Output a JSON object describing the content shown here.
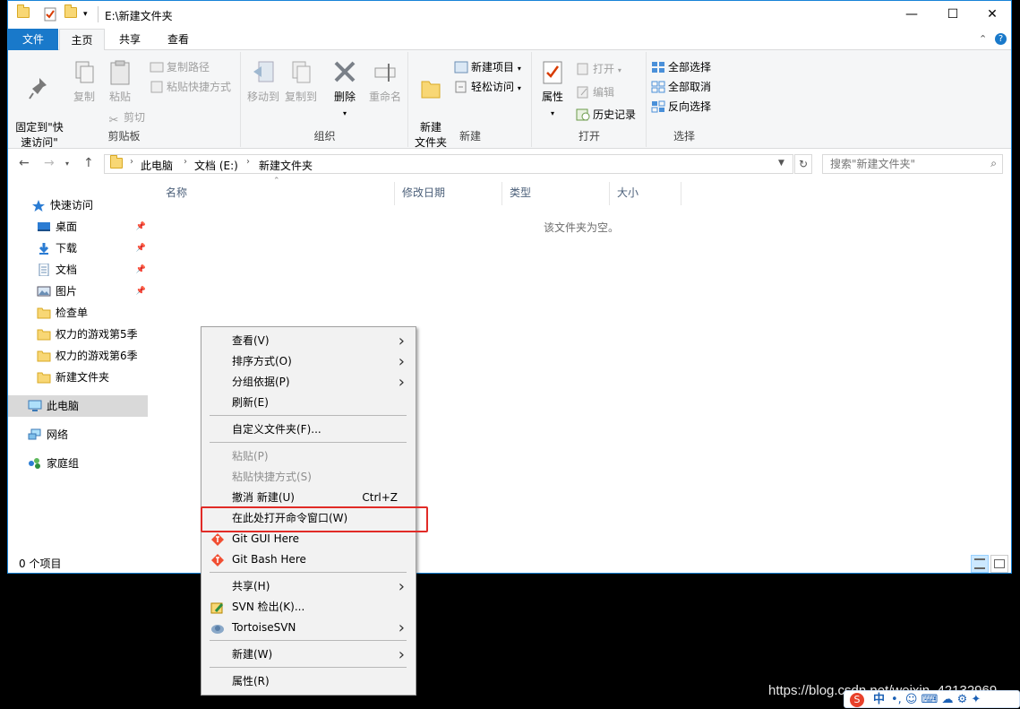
{
  "window": {
    "title": "E:\\新建文件夹",
    "minimize_glyph": "—",
    "maximize_glyph": "☐",
    "close_glyph": "✕"
  },
  "tabs": {
    "file": "文件",
    "home": "主页",
    "share": "共享",
    "view": "查看"
  },
  "ribbon": {
    "clipboard": {
      "group": "剪贴板",
      "pin_quick": "固定到\"快\n速访问\"",
      "copy": "复制",
      "paste": "粘贴",
      "copy_path": "复制路径",
      "paste_shortcut": "粘贴快捷方式",
      "cut": "剪切"
    },
    "organize": {
      "group": "组织",
      "move_to": "移动到",
      "copy_to": "复制到",
      "delete": "删除",
      "rename": "重命名"
    },
    "new": {
      "group": "新建",
      "new_folder": "新建\n文件夹",
      "new_item": "新建项目",
      "easy_access": "轻松访问"
    },
    "open": {
      "group": "打开",
      "properties": "属性",
      "open": "打开",
      "edit": "编辑",
      "history": "历史记录"
    },
    "select": {
      "group": "选择",
      "select_all": "全部选择",
      "select_none": "全部取消",
      "invert": "反向选择"
    }
  },
  "address": {
    "crumbs": [
      "此电脑",
      "文档 (E:)",
      "新建文件夹"
    ],
    "search_placeholder": "搜索\"新建文件夹\""
  },
  "sidebar": {
    "items": [
      {
        "label": "快速访问",
        "icon": "star-icon"
      },
      {
        "label": "桌面",
        "icon": "desktop-icon",
        "pinned": true
      },
      {
        "label": "下载",
        "icon": "download-icon",
        "pinned": true
      },
      {
        "label": "文档",
        "icon": "document-icon",
        "pinned": true
      },
      {
        "label": "图片",
        "icon": "picture-icon",
        "pinned": true
      },
      {
        "label": "检查单",
        "icon": "folder-icon"
      },
      {
        "label": "权力的游戏第5季",
        "icon": "folder-icon"
      },
      {
        "label": "权力的游戏第6季",
        "icon": "folder-icon"
      },
      {
        "label": "新建文件夹",
        "icon": "folder-icon"
      },
      {
        "label": "此电脑",
        "icon": "computer-icon",
        "selected": true
      },
      {
        "label": "网络",
        "icon": "network-icon"
      },
      {
        "label": "家庭组",
        "icon": "homegroup-icon"
      }
    ]
  },
  "columns": [
    "名称",
    "修改日期",
    "类型",
    "大小"
  ],
  "empty_message": "该文件夹为空。",
  "status": "0 个项目",
  "context_menu": {
    "items": [
      {
        "label": "查看(V)",
        "submenu": true
      },
      {
        "label": "排序方式(O)",
        "submenu": true
      },
      {
        "label": "分组依据(P)",
        "submenu": true
      },
      {
        "label": "刷新(E)"
      },
      {
        "label": "自定义文件夹(F)..."
      },
      {
        "label": "粘贴(P)",
        "disabled": true
      },
      {
        "label": "粘贴快捷方式(S)",
        "disabled": true
      },
      {
        "label": "撤消 新建(U)",
        "accelerator": "Ctrl+Z"
      },
      {
        "label": "在此处打开命令窗口(W)",
        "highlighted": true
      },
      {
        "label": "Git GUI Here",
        "icon": "git-icon"
      },
      {
        "label": "Git Bash Here",
        "icon": "git-icon"
      },
      {
        "label": "共享(H)",
        "submenu": true
      },
      {
        "label": "SVN 检出(K)...",
        "icon": "svn-checkout-icon"
      },
      {
        "label": "TortoiseSVN",
        "icon": "tortoisesvn-icon",
        "submenu": true
      },
      {
        "label": "新建(W)",
        "submenu": true
      },
      {
        "label": "属性(R)"
      }
    ]
  },
  "watermark": "https://blog.csdn.net/weixin_42132969",
  "tray": {
    "ime": "中",
    "symbols": "•, ☺ ⌨ ☁ ⚙ ✦"
  },
  "colors": {
    "accent": "#1979ca",
    "highlight_box": "#e12b27",
    "menu_bg": "#f2f2f2"
  }
}
